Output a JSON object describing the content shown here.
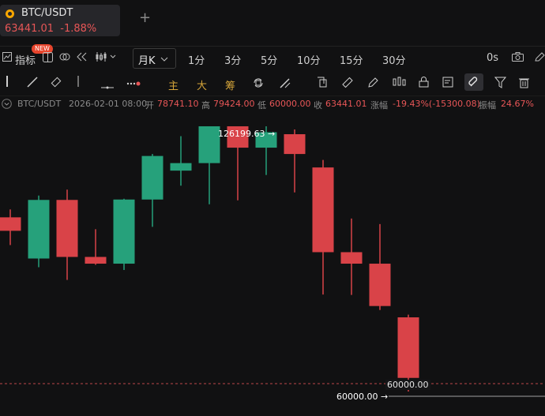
{
  "tab": {
    "symbol": "BTC/USDT",
    "price": "63441.01",
    "change": "-1.88%",
    "add_label": "+"
  },
  "toolbar": {
    "indicators_label": "指标",
    "new_badge": "NEW",
    "interval_selected": "月K",
    "intervals": [
      "1分",
      "3分",
      "5分",
      "10分",
      "15分",
      "30分"
    ],
    "zero_s": "0s"
  },
  "drawing_tools": {
    "labels": [
      "主",
      "大",
      "筹"
    ]
  },
  "info_bar": {
    "symbol": "BTC/USDT",
    "time": "2026-02-01 08:00",
    "open_label": "开",
    "open": "78741.10",
    "high_label": "高",
    "high": "79424.00",
    "low_label": "低",
    "low": "60000.00",
    "close_label": "收",
    "close": "63441.01",
    "change_label": "涨幅",
    "change": "-19.43%(-15300.08)",
    "amplitude_label": "振幅",
    "amplitude": "24.67%"
  },
  "chart_data": {
    "type": "candlestick",
    "interval": "月K",
    "last_price_line": "60000.00",
    "max_annotation": "126199.63",
    "min_annotation": "60000.00",
    "ylim": [
      57500,
      128600
    ],
    "candles": [
      {
        "o": 104000,
        "h": 106000,
        "l": 97000,
        "c": 100600
      },
      {
        "o": 93600,
        "h": 109500,
        "l": 91400,
        "c": 108400
      },
      {
        "o": 108400,
        "h": 111000,
        "l": 88200,
        "c": 94000
      },
      {
        "o": 94000,
        "h": 101000,
        "l": 92000,
        "c": 92300
      },
      {
        "o": 92300,
        "h": 108700,
        "l": 90700,
        "c": 108500
      },
      {
        "o": 108500,
        "h": 120000,
        "l": 101600,
        "c": 119500
      },
      {
        "o": 115800,
        "h": 124500,
        "l": 112000,
        "c": 117700
      },
      {
        "o": 117700,
        "h": 123200,
        "l": 107300,
        "c": 127000
      },
      {
        "o": 127000,
        "h": 126200,
        "l": 108300,
        "c": 121600
      },
      {
        "o": 121600,
        "h": 127000,
        "l": 114700,
        "c": 125500
      },
      {
        "o": 125000,
        "h": 126199.63,
        "l": 110300,
        "c": 120000
      },
      {
        "o": 116600,
        "h": 118500,
        "l": 84500,
        "c": 95200
      },
      {
        "o": 95200,
        "h": 103700,
        "l": 84400,
        "c": 92300
      },
      {
        "o": 92300,
        "h": 102300,
        "l": 80600,
        "c": 81600
      },
      {
        "o": 78741.1,
        "h": 79424.0,
        "l": 60000.0,
        "c": 63441.01
      }
    ],
    "colors": {
      "up": "#26a17b",
      "down": "#d94348",
      "price_line": "#e85657"
    }
  }
}
